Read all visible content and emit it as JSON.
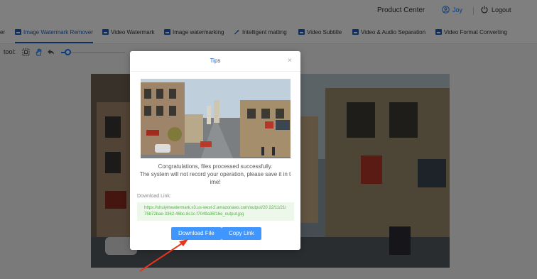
{
  "header": {
    "product_center": "Product Center",
    "user_name": "Joy",
    "logout": "Logout"
  },
  "tabs": [
    {
      "label": "Image Watermark Remover",
      "active": true
    },
    {
      "label": "Video Watermark",
      "active": false
    },
    {
      "label": "Image watermarking",
      "active": false
    },
    {
      "label": "Intelligent matting",
      "active": false
    },
    {
      "label": "Video Subtitle",
      "active": false
    },
    {
      "label": "Video & Audio Separation",
      "active": false
    },
    {
      "label": "Video Format Converting",
      "active": false
    }
  ],
  "tab_prefix": "er",
  "toolbar": {
    "label": "tool:",
    "brush_size_fraction": 0.08,
    "tools": [
      "select-rect-icon",
      "hand-icon",
      "undo-icon"
    ]
  },
  "dialog": {
    "title": "Tips",
    "close": "×",
    "message": "Congratulations, files processed successfully.\nThe system will not record your operation, please save it in t ime!",
    "download_label": "Download Link:",
    "download_url": "https://shuiyinwatermark.s3.us-west-2.amazonaws.com/output/20 22/11/21/75b72bae-3362-46bc-8c1c-f7049a35f16e_output.jpg",
    "download_button": "Download File",
    "copy_button": "Copy Link"
  },
  "colors": {
    "accent": "#1e5fc2",
    "button": "#4096ff",
    "link_green": "#52b04a",
    "annotation_arrow": "#e8341c"
  }
}
